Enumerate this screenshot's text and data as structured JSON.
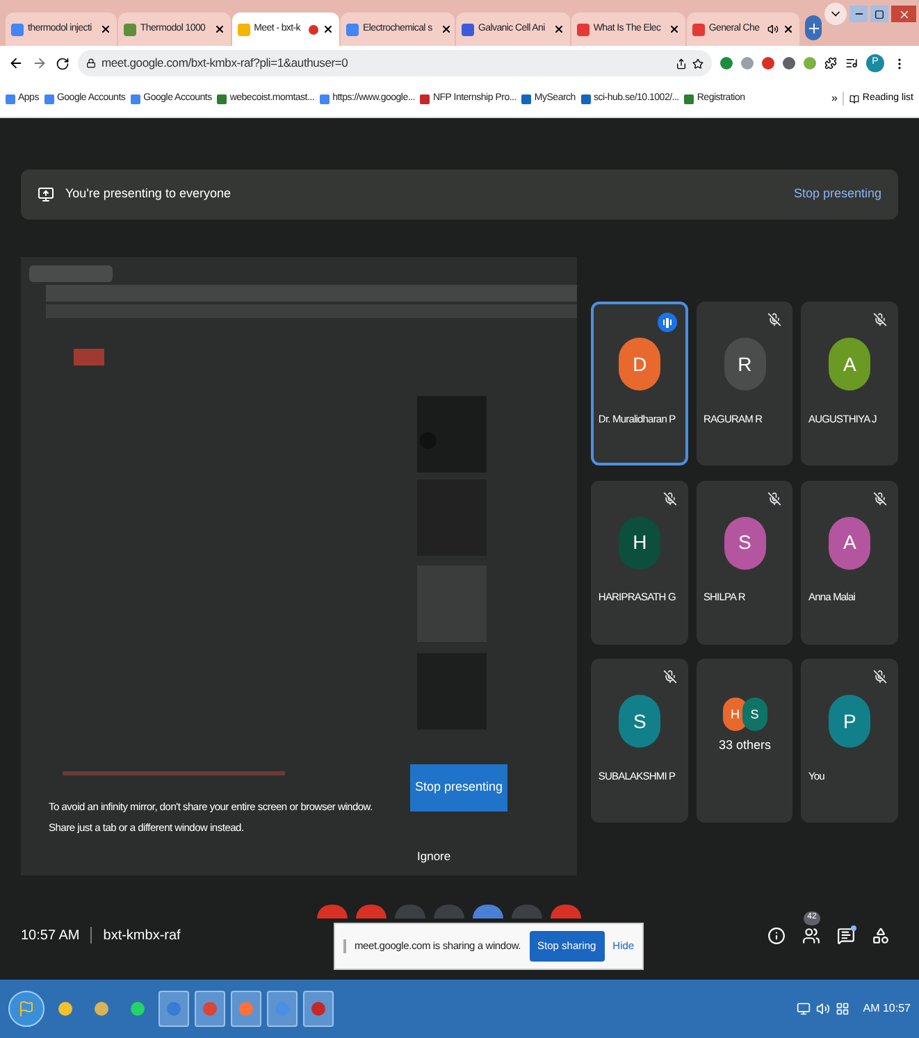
{
  "browser": {
    "tabs": [
      {
        "title": "thermodol injecti",
        "selected": false,
        "color": "#4285f4",
        "audio": false,
        "recording": false
      },
      {
        "title": "Thermodol 1000",
        "selected": false,
        "color": "#5f8f3a",
        "audio": false,
        "recording": false
      },
      {
        "title": "Meet - bxt-k",
        "selected": true,
        "color": "#f4b400",
        "audio": false,
        "recording": true
      },
      {
        "title": "Electrochemical s",
        "selected": false,
        "color": "#4285f4",
        "audio": false,
        "recording": false
      },
      {
        "title": "Galvanic Cell Ani",
        "selected": false,
        "color": "#3b5bdb",
        "audio": false,
        "recording": false
      },
      {
        "title": "What Is The Elec",
        "selected": false,
        "color": "#e53935",
        "audio": false,
        "recording": false
      },
      {
        "title": "General Che",
        "selected": false,
        "color": "#e53935",
        "audio": true,
        "recording": false
      }
    ],
    "url": "meet.google.com/bxt-kmbx-raf?pli=1&authuser=0",
    "profile_initial": "P",
    "extensions": [
      {
        "color": "#1e8e3e"
      },
      {
        "color": "#9aa0a6"
      },
      {
        "color": "#d93025"
      },
      {
        "color": "#5f6368"
      },
      {
        "color": "#7cb342"
      }
    ],
    "bookmarks": [
      {
        "label": "Apps",
        "color": "#4285f4"
      },
      {
        "label": "Google Accounts",
        "color": "#4285f4"
      },
      {
        "label": "Google Accounts",
        "color": "#4285f4"
      },
      {
        "label": "webecoist.momtast...",
        "color": "#2e7d32"
      },
      {
        "label": "https://www.google...",
        "color": "#4285f4"
      },
      {
        "label": "NFP Internship Pro...",
        "color": "#c62828"
      },
      {
        "label": "MySearch",
        "color": "#1565c0"
      },
      {
        "label": "sci-hub.se/10.1002/...",
        "color": "#1565c0"
      },
      {
        "label": "Registration",
        "color": "#2e7d32"
      }
    ],
    "more": "»",
    "reading_list": "Reading list"
  },
  "meet": {
    "banner": {
      "text": "You're presenting to everyone",
      "action": "Stop presenting"
    },
    "preview": {
      "message_lines": [
        "To avoid an infinity mirror, don't share your entire screen or browser window.",
        "Share just a tab or a different window instead."
      ],
      "stop_button": "Stop presenting",
      "ignore": "Ignore"
    },
    "tiles": [
      {
        "kind": "person",
        "initial": "D",
        "name": "Dr. Muralidharan P",
        "color": "#e8692e",
        "muted": false,
        "speaking": true
      },
      {
        "kind": "person",
        "initial": "R",
        "name": "RAGURAM R",
        "color": "#4a4d4c",
        "muted": true,
        "speaking": false
      },
      {
        "kind": "person",
        "initial": "A",
        "name": "AUGUSTHIYA J",
        "color": "#6a9a24",
        "muted": true,
        "speaking": false
      },
      {
        "kind": "person",
        "initial": "H",
        "name": "HARIPRASATH G",
        "color": "#0b4f3c",
        "muted": true,
        "speaking": false
      },
      {
        "kind": "person",
        "initial": "S",
        "name": "SHILPA R",
        "color": "#b4559f",
        "muted": true,
        "speaking": false
      },
      {
        "kind": "person",
        "initial": "A",
        "name": "Anna Malai",
        "color": "#b4559f",
        "muted": true,
        "speaking": false
      },
      {
        "kind": "person",
        "initial": "S",
        "name": "SUBALAKSHMI P",
        "color": "#11808a",
        "muted": true,
        "speaking": false
      },
      {
        "kind": "others",
        "label": "33 others",
        "avatars": [
          {
            "initial": "H",
            "color": "#e8692e"
          },
          {
            "initial": "S",
            "color": "#0f7466"
          }
        ]
      },
      {
        "kind": "person",
        "initial": "P",
        "name": "You",
        "color": "#11808a",
        "muted": true,
        "speaking": false
      }
    ],
    "bottom": {
      "time": "10:57 AM",
      "code": "bxt-kmbx-raf",
      "people_count": "42",
      "chat_unread": true
    },
    "call_controls": [
      {
        "color": "#d93025"
      },
      {
        "color": "#d93025"
      },
      {
        "color": "#3c4043"
      },
      {
        "color": "#3c4043"
      },
      {
        "color": "#4a7fd6"
      },
      {
        "color": "#3c4043"
      },
      {
        "color": "#d93025"
      }
    ],
    "sharing_notice": {
      "text": "meet.google.com is sharing a window.",
      "stop": "Stop sharing",
      "hide": "Hide"
    }
  },
  "taskbar": {
    "apps": [
      {
        "color": "#f2c12e",
        "active": false
      },
      {
        "color": "#d7b35a",
        "active": false
      },
      {
        "color": "#25d366",
        "active": false
      },
      {
        "color": "#3a7bd5",
        "active": true
      },
      {
        "color": "#db4437",
        "active": true
      },
      {
        "color": "#ff7139",
        "active": true
      },
      {
        "color": "#4a90e2",
        "active": true
      },
      {
        "color": "#c62828",
        "active": true
      }
    ],
    "clock": "AM 10:57"
  }
}
